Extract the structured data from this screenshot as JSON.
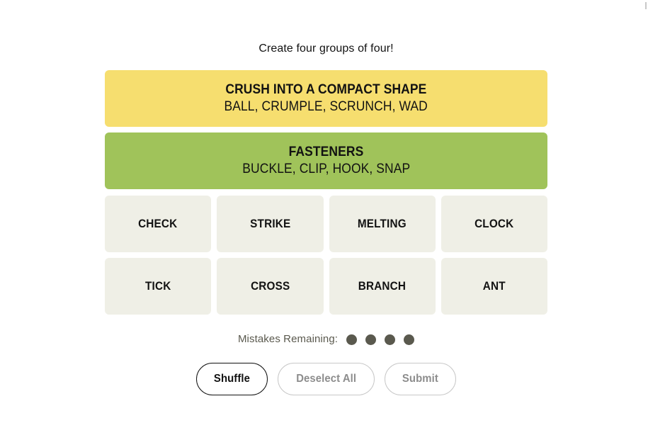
{
  "game": {
    "instruction": "Create four groups of four!"
  },
  "solved_groups": [
    {
      "title": "CRUSH INTO A COMPACT SHAPE",
      "members": "BALL, CRUMPLE, SCRUNCH, WAD",
      "color": "#f6de6f",
      "difficulty": "yellow"
    },
    {
      "title": "FASTENERS",
      "members": "BUCKLE, CLIP, HOOK, SNAP",
      "color": "#a0c35a",
      "difficulty": "green"
    }
  ],
  "tiles": [
    {
      "label": "CHECK"
    },
    {
      "label": "STRIKE"
    },
    {
      "label": "MELTING"
    },
    {
      "label": "CLOCK"
    },
    {
      "label": "TICK"
    },
    {
      "label": "CROSS"
    },
    {
      "label": "BRANCH"
    },
    {
      "label": "ANT"
    }
  ],
  "mistakes": {
    "label": "Mistakes Remaining:",
    "remaining": 4,
    "dot_color": "#5a594e"
  },
  "controls": [
    {
      "label": "Shuffle",
      "state": "enabled",
      "name": "shuffle-button"
    },
    {
      "label": "Deselect All",
      "state": "disabled",
      "name": "deselect-all-button"
    },
    {
      "label": "Submit",
      "state": "disabled",
      "name": "submit-button"
    }
  ],
  "theme": {
    "tile_background": "#efefe6",
    "text_color": "#121212",
    "page_background": "#ffffff"
  }
}
